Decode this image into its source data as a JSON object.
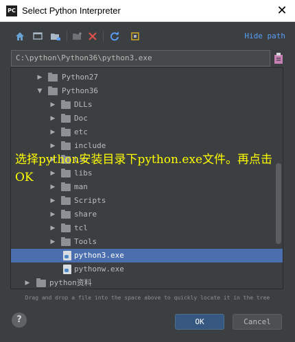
{
  "window": {
    "title": "Select Python Interpreter",
    "app_icon_text": "PC",
    "close_glyph": "✕"
  },
  "toolbar": {
    "icons": [
      "home-icon",
      "desktop-icon",
      "project-icon",
      "new-folder-icon",
      "delete-icon",
      "refresh-icon",
      "show-hidden-icon"
    ],
    "hide_path_label": "Hide path"
  },
  "path": {
    "value": "C:\\python\\Python36\\python3.exe"
  },
  "tree": {
    "rows": [
      {
        "label": "Python27",
        "kind": "folder",
        "expanded": false,
        "depth": 2
      },
      {
        "label": "Python36",
        "kind": "folder",
        "expanded": true,
        "depth": 2
      },
      {
        "label": "DLLs",
        "kind": "folder",
        "expanded": false,
        "depth": 3
      },
      {
        "label": "Doc",
        "kind": "folder",
        "expanded": false,
        "depth": 3
      },
      {
        "label": "etc",
        "kind": "folder",
        "expanded": false,
        "depth": 3
      },
      {
        "label": "include",
        "kind": "folder",
        "expanded": false,
        "depth": 3
      },
      {
        "label": "Lib",
        "kind": "folder",
        "expanded": false,
        "depth": 3
      },
      {
        "label": "libs",
        "kind": "folder",
        "expanded": false,
        "depth": 3
      },
      {
        "label": "man",
        "kind": "folder",
        "expanded": false,
        "depth": 3
      },
      {
        "label": "Scripts",
        "kind": "folder",
        "expanded": false,
        "depth": 3
      },
      {
        "label": "share",
        "kind": "folder",
        "expanded": false,
        "depth": 3
      },
      {
        "label": "tcl",
        "kind": "folder",
        "expanded": false,
        "depth": 3
      },
      {
        "label": "Tools",
        "kind": "folder",
        "expanded": false,
        "depth": 3
      },
      {
        "label": "python3.exe",
        "kind": "file",
        "depth": 3,
        "selected": true
      },
      {
        "label": "pythonw.exe",
        "kind": "file",
        "depth": 3
      },
      {
        "label": "python资料",
        "kind": "folder",
        "expanded": false,
        "depth": 1
      }
    ]
  },
  "annotation": {
    "text": "选择python安装目录下python.exe文件。再点击OK"
  },
  "hint": {
    "text": "Drag and drop a file into the space above to quickly locate it in the tree"
  },
  "footer": {
    "help_label": "?",
    "ok_label": "OK",
    "cancel_label": "Cancel"
  },
  "colors": {
    "accent": "#4b6eaf",
    "link": "#589df6",
    "annotation": "#ffff00",
    "background": "#3c3f41"
  }
}
